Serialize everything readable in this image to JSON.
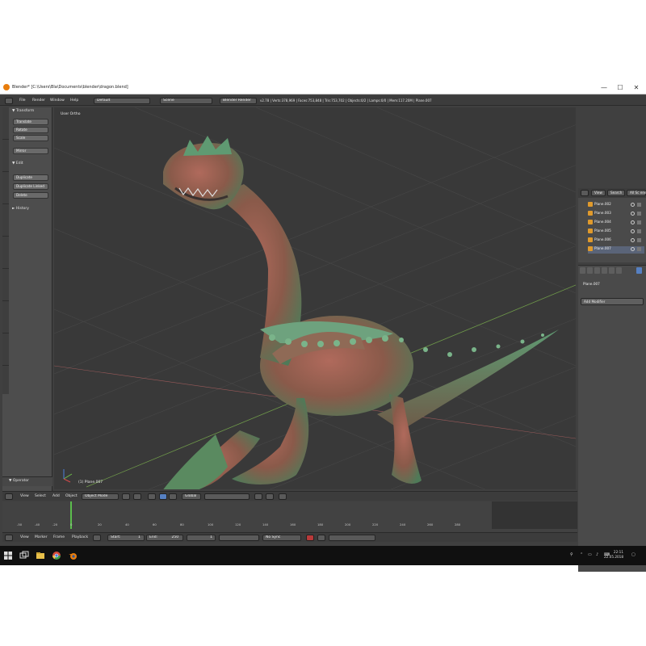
{
  "window": {
    "title": "Blender* [C:\\Users\\Bla\\Documents\\blender\\dragon.blend]",
    "minimize": "—",
    "maximize": "☐",
    "close": "✕"
  },
  "info_header": {
    "menus": [
      "File",
      "Render",
      "Window",
      "Help"
    ],
    "layout": "Default",
    "scene": "Scene",
    "engine": "Blender Render",
    "stats": "v2.78 | Verts:378,969 | Faces:753,848 | Tris:753,702 | Objects:0/2 | Lamps:0/0 | Mem:117.20M | Plane.007"
  },
  "toolshelf": {
    "transform_header": "▼ Transform",
    "transform_buttons": [
      "Translate",
      "Rotate",
      "Scale"
    ],
    "mirror": "Mirror",
    "edit_header": "▼ Edit",
    "edit_buttons": [
      "Duplicate",
      "Duplicate Linked",
      "Delete"
    ],
    "history_header": "► History",
    "operator_header": "▼ Operator"
  },
  "viewport": {
    "label": "User Ortho",
    "object_label": "(1) Plane.007"
  },
  "outliner": {
    "view": "View",
    "search": "Search",
    "all_scenes": "All Sc ene",
    "rows": [
      "Plane.002",
      "Plane.003",
      "Plane.004",
      "Plane.005",
      "Plane.006",
      "Plane.007"
    ]
  },
  "properties": {
    "object_path": "Plane.007",
    "add_modifier": "Add Modifier"
  },
  "view3d_header": {
    "menus": [
      "View",
      "Select",
      "Add",
      "Object"
    ],
    "mode": "Object Mode",
    "orientation": "Global"
  },
  "timeline": {
    "ticks": [
      "-50",
      "-40",
      "-20",
      "0",
      "20",
      "40",
      "60",
      "80",
      "100",
      "120",
      "140",
      "160",
      "180",
      "200",
      "220",
      "240",
      "260",
      "280"
    ],
    "menus": [
      "View",
      "Marker",
      "Frame",
      "Playback"
    ],
    "start_label": "Start:",
    "start_value": "1",
    "end_label": "End:",
    "end_value": "250",
    "current": "1",
    "sync": "No Sync"
  },
  "taskbar": {
    "time": "22:11",
    "date": "22.05.2018"
  },
  "colors": {
    "accent": "#5680c2",
    "blender_orange": "#e87d0d",
    "playhead": "#5bbd4c"
  }
}
